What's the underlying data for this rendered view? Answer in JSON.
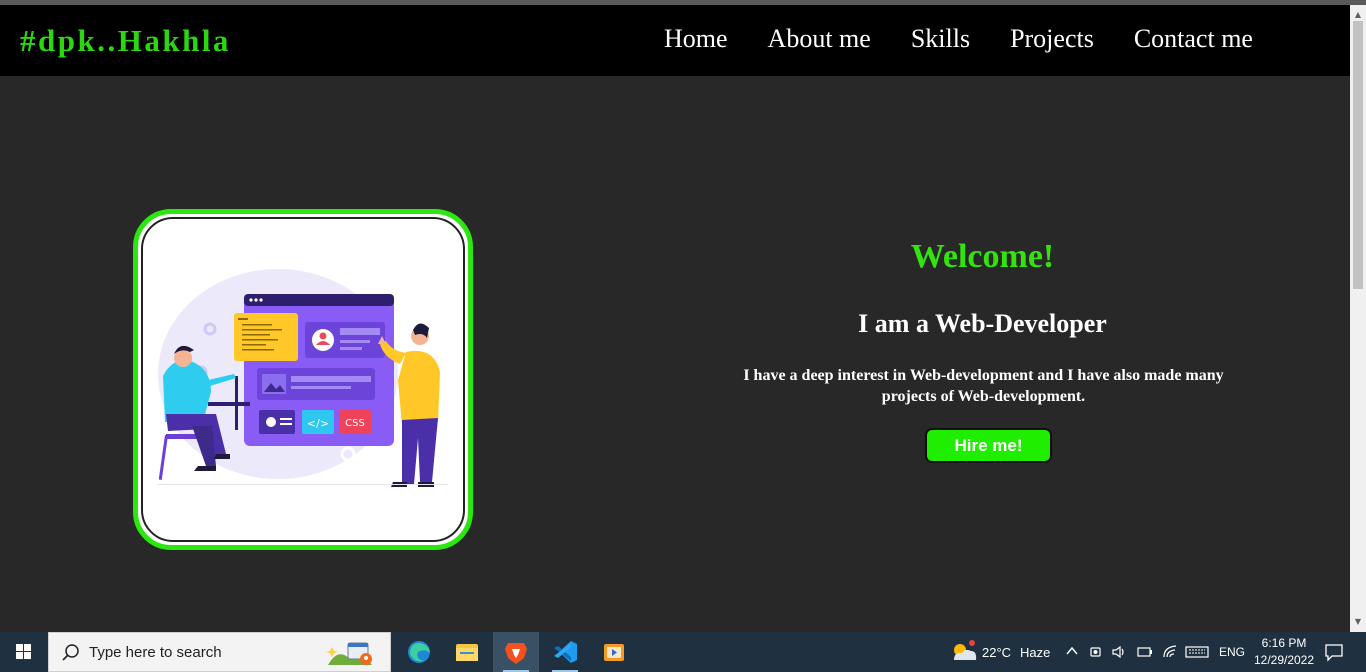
{
  "site": {
    "brand": "#dpk..Hakhla",
    "nav": [
      {
        "label": "Home"
      },
      {
        "label": "About me"
      },
      {
        "label": "Skills"
      },
      {
        "label": "Projects"
      },
      {
        "label": "Contact me"
      }
    ]
  },
  "hero": {
    "welcome": "Welcome!",
    "role": "I am a Web-Developer",
    "intro": "I have a deep interest in Web-development and I have also made many projects of Web-development.",
    "hire_button": "Hire me!",
    "illustration_labels": {
      "code": "</>",
      "css": "CSS"
    }
  },
  "taskbar": {
    "search_placeholder": "Type here to search",
    "apps": [
      "edge-icon",
      "file-explorer-icon",
      "brave-icon",
      "vscode-icon",
      "media-player-icon"
    ],
    "weather": {
      "temp": "22°C",
      "condition": "Haze"
    },
    "language": "ENG",
    "time": "6:16 PM",
    "date": "12/29/2022"
  },
  "colors": {
    "brand_green": "#2bd70f",
    "button_green": "#1fee00",
    "page_bg": "#282828",
    "nav_bg": "#000000"
  }
}
